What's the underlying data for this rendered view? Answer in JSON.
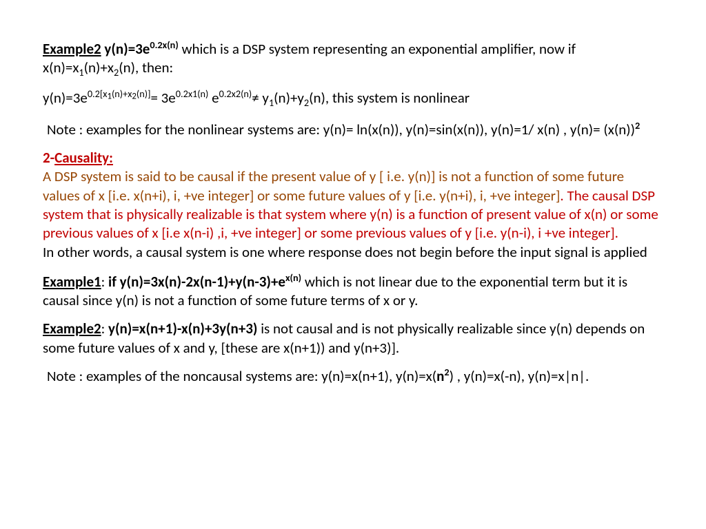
{
  "example2_top": {
    "label": "Example2",
    "eq_prefix": " y(n)=3e",
    "eq_exp": "0.2x(n)",
    "text_after": " which is a DSP system representing an exponential amplifier, now if  x(n)=x",
    "sub1": "1",
    "mid1": "(n)+x",
    "sub2": "2",
    "tail": "(n), then:"
  },
  "deriv": {
    "p1": "y(n)=3e",
    "exp1_a": "0.2[x",
    "exp1_sub1": "1",
    "exp1_b": "(n)+x",
    "exp1_sub2": "2",
    "exp1_c": "(n)]",
    "eq": "= 3e",
    "exp2": "0.2x1(n)",
    "sp": " e",
    "exp3": "0.2x2(n)",
    "neq": "≠  y",
    "dsub1": "1",
    "mid": "(n)+y",
    "dsub2": "2",
    "tail": "(n), this system is nonlinear"
  },
  "note1": {
    "text_a": "Note : examples for the nonlinear systems are: y(n)= ln(x(n)), y(n)=sin(x(n)), y(n)=1/ x(n) , y(n)= (x(n))",
    "sup": "2"
  },
  "causality": {
    "num": "2-",
    "title": "Causality:",
    "brown_a": " A DSP system is said to be causal if the present value of  y [ i.e. y(n)] is not a function of some future values of x [i.e. x(n+i), i, +ve integer] or some future values of y [i.e. y(n+i), i, +ve integer",
    "brown_end": "]",
    "red_b": ". The causal DSP system that is  physically realizable is that system where y(n) is a function of present value of x(n) or some previous values of x [i.e x(n-i) ,i, +ve integer] or some previous values of y [i.e. y(n-i), i +ve integer].",
    "black_c": "In other words, a causal system is one where response does not begin before the input signal is applied"
  },
  "ex1": {
    "label": "Example1",
    "colon": ": ",
    "bold_a": "if y(n)=3x(n)-2x(n-1)+y(n-3)+e",
    "bold_exp": "x(n)",
    "text_b": "  which is not linear due to the exponential term but it is causal since y(n) is not a function of some future terms of x or y."
  },
  "ex2": {
    "label": "Example2",
    "colon": ": ",
    "bold_a": "y(n)=x(n+1)-x(n)+3y(n+3)",
    "text_b": " is not causal and is not physically realizable since y(n) depends on some future values of x and y,   [these are x(n+1)) and  y(n+3)]."
  },
  "note2": {
    "a": "Note : examples of the noncausal systems are: y(n)=x(n+1), y(n)=x(",
    "bold_n": "n",
    "bold_sup": "2",
    "b": ") , y(n)=x(-n), y(n)=x|n|."
  }
}
